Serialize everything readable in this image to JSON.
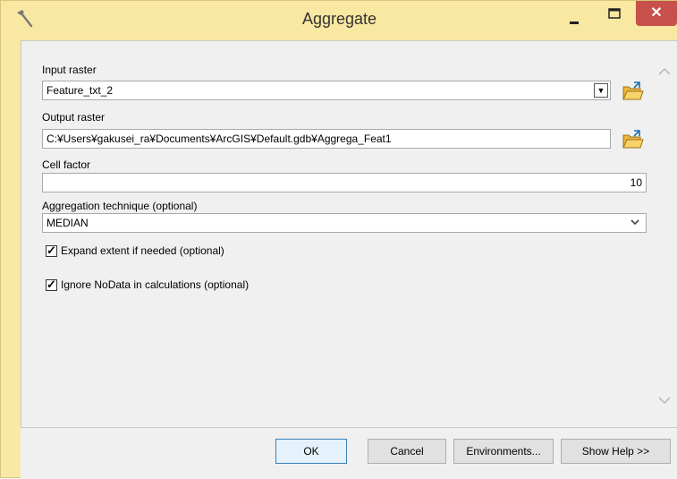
{
  "window": {
    "title": "Aggregate",
    "close_glyph": "✕",
    "accent_color": "#f9e8a1",
    "close_color": "#c7504a"
  },
  "form": {
    "input_raster": {
      "label": "Input raster",
      "value": "Feature_txt_2"
    },
    "output_raster": {
      "label": "Output raster",
      "value": "C:¥Users¥gakusei_ra¥Documents¥ArcGIS¥Default.gdb¥Aggrega_Feat1"
    },
    "cell_factor": {
      "label": "Cell factor",
      "value": "10"
    },
    "aggregation_technique": {
      "label": "Aggregation technique (optional)",
      "value": "MEDIAN"
    },
    "expand_extent": {
      "label": "Expand extent if needed (optional)",
      "checked": true
    },
    "ignore_nodata": {
      "label": "Ignore NoData in calculations (optional)",
      "checked": true
    }
  },
  "icons": {
    "app": "hammer-icon",
    "minimize": "minimize-icon",
    "maximize": "maximize-icon",
    "close": "close-icon",
    "browse": "folder-open-icon",
    "dropdown": "dropdown-arrow-icon",
    "chevron": "chevron-down-icon",
    "scroll_up": "scroll-up-icon",
    "scroll_down": "scroll-down-icon"
  },
  "buttons": {
    "ok": "OK",
    "cancel": "Cancel",
    "environments": "Environments...",
    "show_help": "Show Help >>"
  }
}
